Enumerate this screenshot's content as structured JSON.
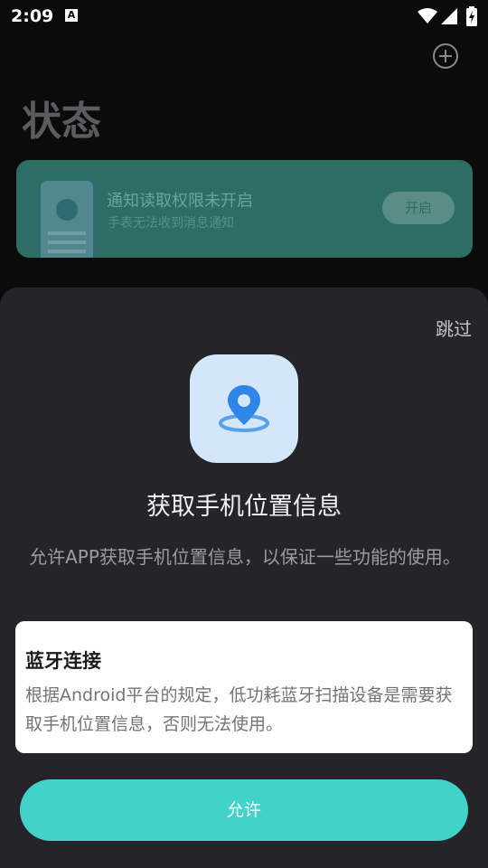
{
  "status_bar": {
    "time": "2:09",
    "notification_icon": "A",
    "icons": [
      "wifi-icon",
      "signal-icon",
      "battery-charging-icon"
    ]
  },
  "header": {
    "title": "状态",
    "add_icon": "plus-circle-icon"
  },
  "notification_card": {
    "title": "通知读取权限未开启",
    "subtitle": "手表无法收到消息通知",
    "button_label": "开启",
    "bg_color": "#2d6d64"
  },
  "permission_sheet": {
    "skip_label": "跳过",
    "icon": "location-pin-icon",
    "title": "获取手机位置信息",
    "description": "允许APP获取手机位置信息，以保证一些功能的使用。",
    "info_card": {
      "title": "蓝牙连接",
      "body": "根据Android平台的规定，低功耗蓝牙扫描设备是需要获取手机位置信息，否则无法使用。"
    },
    "allow_label": "允许",
    "accent_color": "#41d3c9"
  }
}
